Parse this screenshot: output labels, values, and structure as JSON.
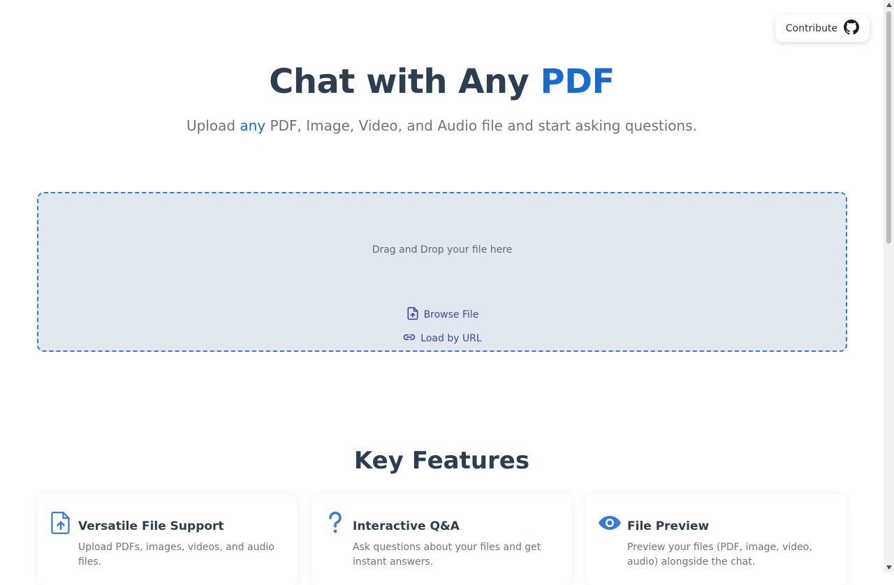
{
  "header": {
    "contribute_label": "Contribute",
    "contribute_icon": "github-icon"
  },
  "hero": {
    "title_prefix": "Chat with Any ",
    "title_accent": "PDF",
    "subtitle_before": "Upload ",
    "subtitle_accent": "any",
    "subtitle_after": " PDF, Image, Video, and Audio file and start asking questions."
  },
  "dropzone": {
    "drop_text": "Drag and Drop your file here",
    "browse_label": "Browse File",
    "browse_icon": "file-upload-icon",
    "url_label": "Load by URL",
    "url_icon": "link-icon"
  },
  "features": {
    "title": "Key Features",
    "cards": [
      {
        "icon": "file-upload-icon",
        "title": "Versatile File Support",
        "desc": "Upload PDFs, images, videos, and audio files."
      },
      {
        "icon": "question-mark-icon",
        "title": "Interactive Q&A",
        "desc": "Ask questions about your files and get instant answers."
      },
      {
        "icon": "eye-icon",
        "title": "File Preview",
        "desc": "Preview your files (PDF, image, video, audio) alongside the chat."
      }
    ]
  },
  "colors": {
    "accent": "#1a6ccc",
    "text_dark": "#2c3e50",
    "dropzone_bg": "#e2e8f0",
    "dropzone_border": "#3a7bd5",
    "icon_blue": "#3a7bd5"
  }
}
